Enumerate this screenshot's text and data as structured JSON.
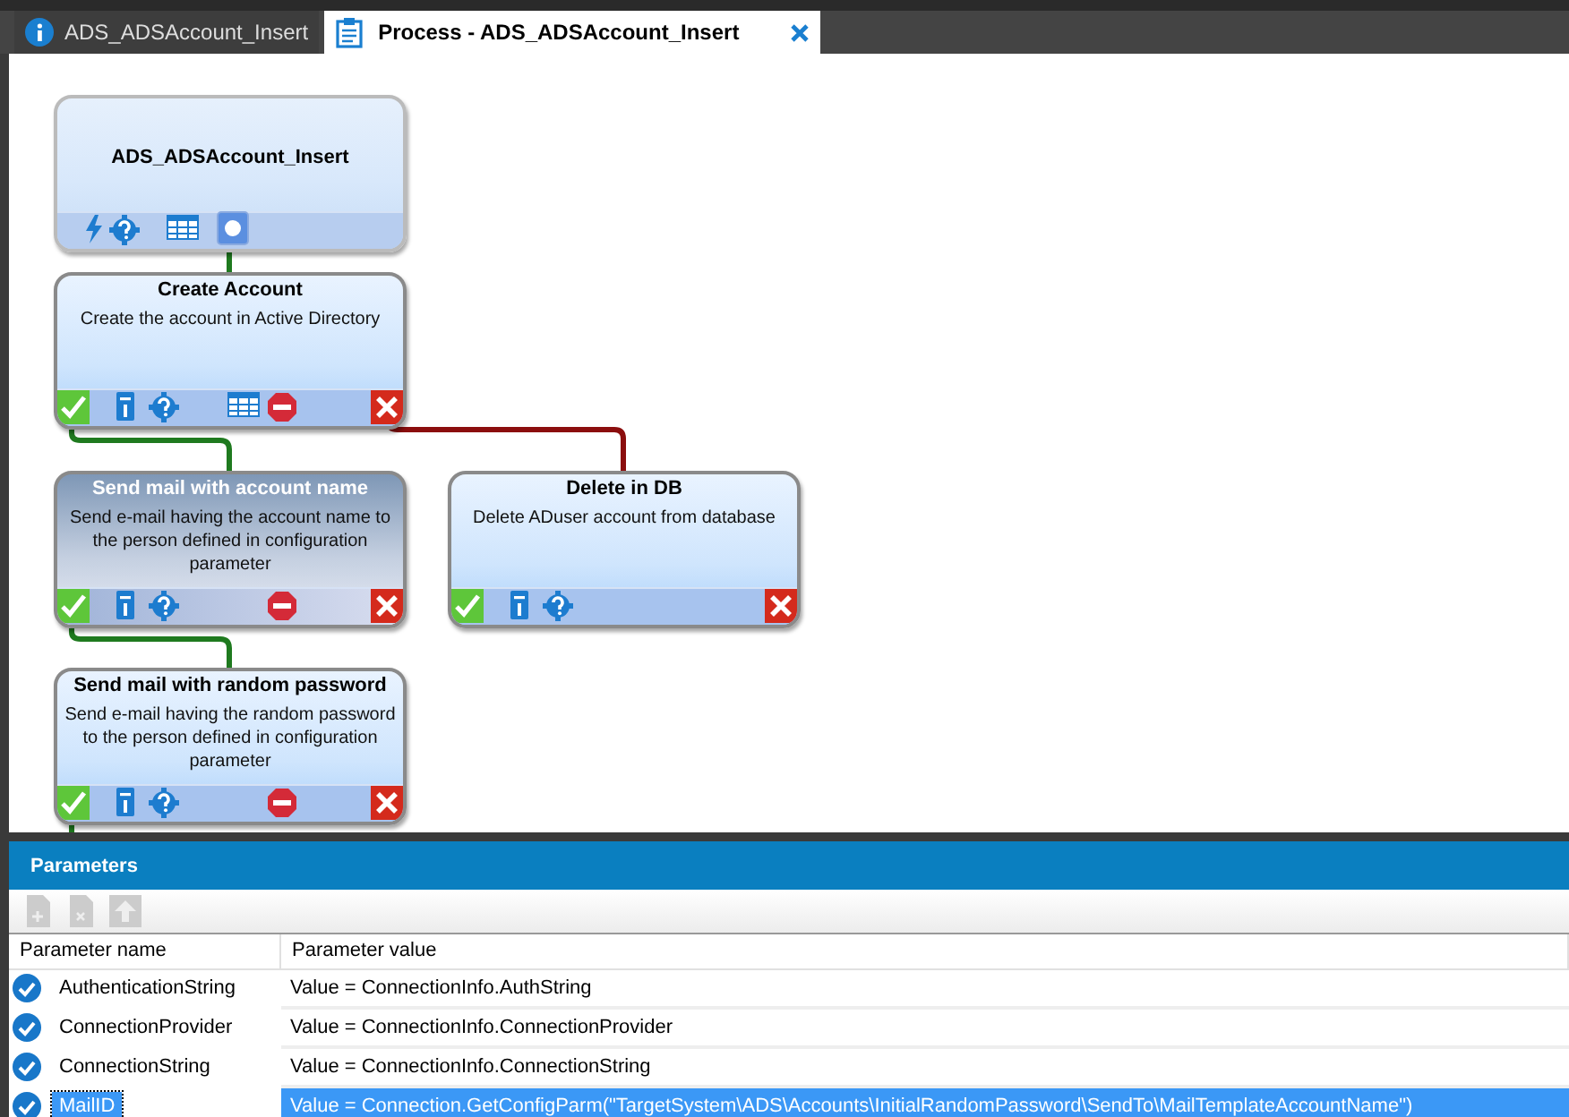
{
  "tabs": [
    {
      "label": "ADS_ADSAccount_Insert",
      "kind": "info",
      "selected": false
    },
    {
      "label": "Process - ADS_ADSAccount_Insert",
      "kind": "process",
      "selected": true,
      "closable": true
    }
  ],
  "diagram": {
    "nodes": [
      {
        "kind": "start",
        "title": "ADS_ADSAccount_Insert",
        "selected": false
      },
      {
        "kind": "step",
        "title": "Create Account",
        "description": "Create the account in Active Directory",
        "selected": false
      },
      {
        "kind": "step",
        "title": "Send mail with account name",
        "description": "Send e-mail having the account name to the person defined in configuration parameter",
        "selected": true
      },
      {
        "kind": "step",
        "title": "Delete in DB",
        "description": "Delete ADuser account from database",
        "selected": false
      },
      {
        "kind": "step",
        "title": "Send mail with random password",
        "description": "Send e-mail having the random password to the person defined in configuration parameter",
        "selected": false
      }
    ]
  },
  "parameters": {
    "title": "Parameters",
    "columns": [
      "Parameter name",
      "Parameter value"
    ],
    "rows": [
      {
        "name": "AuthenticationString",
        "value": "Value = ConnectionInfo.AuthString",
        "selected": false
      },
      {
        "name": "ConnectionProvider",
        "value": "Value = ConnectionInfo.ConnectionProvider",
        "selected": false
      },
      {
        "name": "ConnectionString",
        "value": "Value = ConnectionInfo.ConnectionString",
        "selected": false
      },
      {
        "name": "MailID",
        "value": "Value = Connection.GetConfigParm(\"TargetSystem\\ADS\\Accounts\\InitialRandomPassword\\SendTo\\MailTemplateAccountName\")",
        "selected": true
      }
    ]
  }
}
